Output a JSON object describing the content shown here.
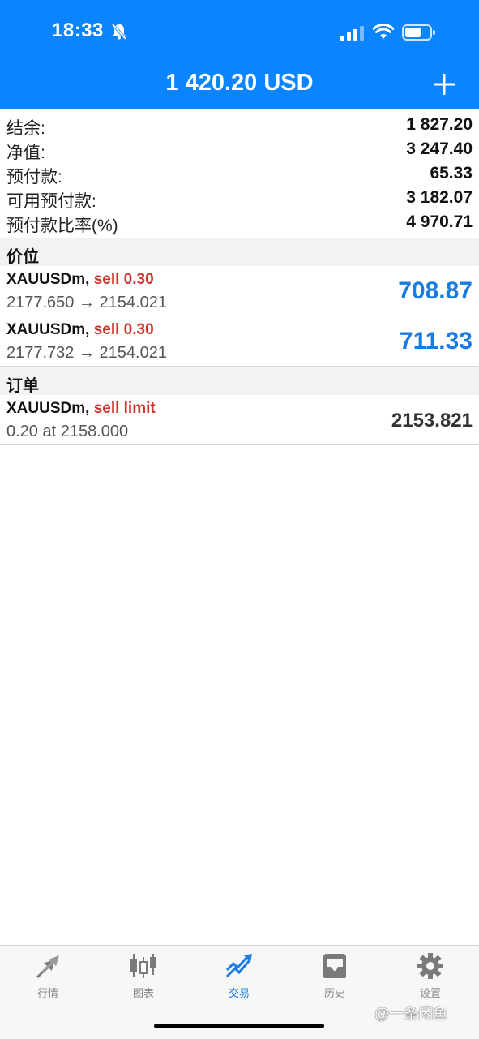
{
  "status_bar": {
    "time": "18:33"
  },
  "header": {
    "balance_title": "1 420.20 USD"
  },
  "summary": [
    {
      "label": "结余:",
      "value": "1 827.20"
    },
    {
      "label": "净值:",
      "value": "3 247.40"
    },
    {
      "label": "预付款:",
      "value": "65.33"
    },
    {
      "label": "可用预付款:",
      "value": "3 182.07"
    },
    {
      "label": "预付款比率(%)",
      "value": "4 970.71"
    }
  ],
  "positions": {
    "header": "价位",
    "items": [
      {
        "symbol": "XAUUSDm,",
        "side": "sell 0.30",
        "prices": "2177.650 → 2154.021",
        "profit": "708.87"
      },
      {
        "symbol": "XAUUSDm,",
        "side": "sell 0.30",
        "prices": "2177.732 → 2154.021",
        "profit": "711.33"
      }
    ]
  },
  "orders": {
    "header": "订单",
    "items": [
      {
        "symbol": "XAUUSDm,",
        "side": "sell limit",
        "detail": "0.20 at 2158.000",
        "price": "2153.821"
      }
    ]
  },
  "tabs": [
    {
      "label": "行情",
      "icon": "quotes-arrows-icon",
      "active": false
    },
    {
      "label": "图表",
      "icon": "candlestick-chart-icon",
      "active": false
    },
    {
      "label": "交易",
      "icon": "trade-trend-icon",
      "active": true
    },
    {
      "label": "历史",
      "icon": "history-inbox-icon",
      "active": false
    },
    {
      "label": "设置",
      "icon": "settings-gear-icon",
      "active": false
    }
  ],
  "watermark": "@一条闲鱼",
  "colors": {
    "header_bg": "#0a84ff",
    "profit": "#1a7be0",
    "sell": "#d0342c",
    "active_tab": "#1a7be0"
  }
}
